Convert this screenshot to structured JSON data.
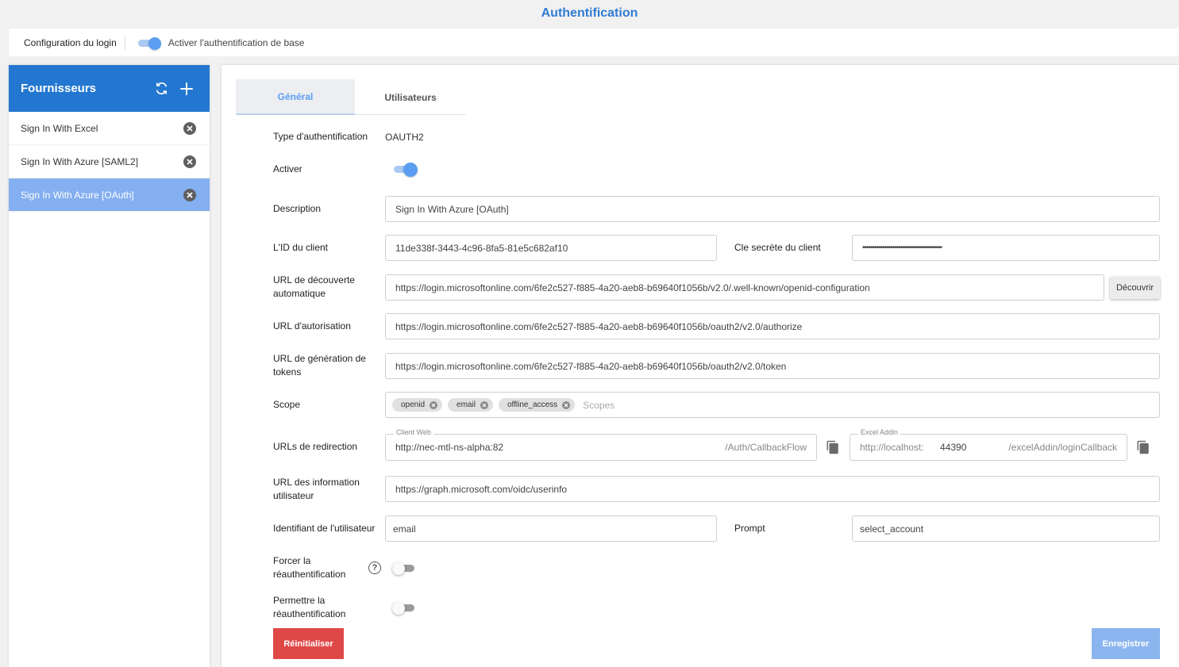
{
  "page": {
    "title": "Authentification"
  },
  "topbar": {
    "config_label": "Configuration du login",
    "basic_auth_label": "Activer l'authentification de base",
    "basic_auth_enabled": true
  },
  "sidebar": {
    "title": "Fournisseurs",
    "icons": {
      "refresh": "refresh-icon",
      "add": "plus-icon",
      "remove": "close-circle-icon"
    },
    "items": [
      {
        "label": "Sign In With Excel"
      },
      {
        "label": "Sign In With Azure [SAML2]"
      },
      {
        "label": "Sign In With Azure [OAuth]",
        "active": true
      }
    ]
  },
  "tabs": [
    {
      "label": "Général",
      "active": true
    },
    {
      "label": "Utilisateurs"
    }
  ],
  "form": {
    "auth_type": {
      "label": "Type d'authentification",
      "value": "OAUTH2"
    },
    "activer": {
      "label": "Activer",
      "enabled": true
    },
    "description": {
      "label": "Description",
      "value": "Sign In With Azure [OAuth]"
    },
    "client_id": {
      "label": "L'ID du client",
      "value": "11de338f-3443-4c96-8fa5-81e5c682af10"
    },
    "client_secret": {
      "label": "Cle secrète du client",
      "value": "••••••••••••••••••••••••••••••••••••••••"
    },
    "discovery_url": {
      "label_1": "URL de découverte",
      "label_2": "automatique",
      "value": "https://login.microsoftonline.com/6fe2c527-f885-4a20-aeb8-b69640f1056b/v2.0/.well-known/openid-configuration",
      "button": "Découvrir"
    },
    "authorize_url": {
      "label": "URL d'autorisation",
      "value": "https://login.microsoftonline.com/6fe2c527-f885-4a20-aeb8-b69640f1056b/oauth2/v2.0/authorize"
    },
    "token_url": {
      "label_1": "URL de génération de",
      "label_2": "tokens",
      "value": "https://login.microsoftonline.com/6fe2c527-f885-4a20-aeb8-b69640f1056b/oauth2/v2.0/token"
    },
    "scope": {
      "label": "Scope",
      "chips": [
        "openid",
        "email",
        "offline_access"
      ],
      "placeholder": "Scopes"
    },
    "redirect": {
      "label": "URLs de redirection",
      "web": {
        "legend": "Client Web",
        "value": "http://nec-mtl-ns-alpha:82",
        "suffix": "/Auth/CallbackFlow"
      },
      "excel": {
        "legend": "Excel Addin",
        "prefix": "http://localhost:",
        "port": "44390",
        "suffix": "/excelAddin/loginCallback"
      },
      "copy_icon": "copy-icon"
    },
    "userinfo_url": {
      "label_1": "URL des information",
      "label_2": "utilisateur",
      "value": "https://graph.microsoft.com/oidc/userinfo"
    },
    "user_identifier": {
      "label": "Identifiant de l'utilisateur",
      "value": "email"
    },
    "prompt": {
      "label": "Prompt",
      "value": "select_account"
    },
    "force_reauth": {
      "label_1": "Forcer la",
      "label_2": "réauthentification",
      "enabled": false,
      "help_icon": "help-circle-icon",
      "help_glyph": "?"
    },
    "allow_reauth": {
      "label_1": "Permettre la",
      "label_2": "réauthentification",
      "enabled": false
    }
  },
  "actions": {
    "reset": "Réinitialiser",
    "save": "Enregistrer"
  },
  "colors": {
    "primary": "#2377d0",
    "accent": "#5b9ef1",
    "danger": "#e04848",
    "save_disabled": "#8bb5ee"
  }
}
